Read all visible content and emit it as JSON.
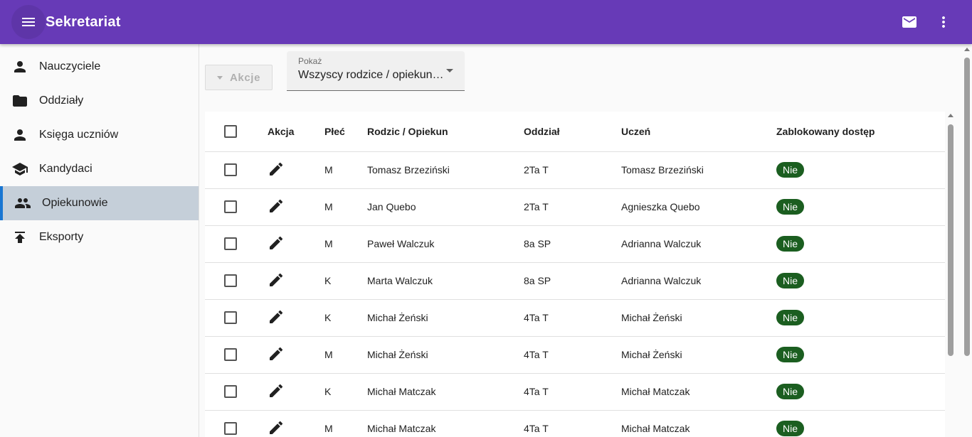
{
  "app": {
    "title": "Sekretariat"
  },
  "topbar": {
    "menu_icon": "menu-icon",
    "mail_icon": "mail-icon",
    "more_icon": "more-vert-icon"
  },
  "sidebar": {
    "items": [
      {
        "label": "Nauczyciele",
        "icon": "person-icon"
      },
      {
        "label": "Oddziały",
        "icon": "folder-icon"
      },
      {
        "label": "Księga uczniów",
        "icon": "person-icon"
      },
      {
        "label": "Kandydaci",
        "icon": "school-icon"
      },
      {
        "label": "Opiekunowie",
        "icon": "people-icon",
        "active": true
      },
      {
        "label": "Eksporty",
        "icon": "upload-icon"
      }
    ]
  },
  "toolbar": {
    "actions_label": "Akcje",
    "show_label": "Pokaż",
    "show_value": "Wszyscy rodzice / opiekunowie"
  },
  "table": {
    "headers": [
      "Akcja",
      "Płeć",
      "Rodzic / Opiekun",
      "Oddział",
      "Uczeń",
      "Zablokowany dostęp"
    ],
    "rows": [
      {
        "sex": "M",
        "parent": "Tomasz Brzeziński",
        "class": "2Ta T",
        "student": "Tomasz Brzeziński",
        "blocked": "Nie"
      },
      {
        "sex": "M",
        "parent": "Jan Quebo",
        "class": "2Ta T",
        "student": "Agnieszka Quebo",
        "blocked": "Nie"
      },
      {
        "sex": "M",
        "parent": "Paweł Walczuk",
        "class": "8a SP",
        "student": "Adrianna Walczuk",
        "blocked": "Nie"
      },
      {
        "sex": "K",
        "parent": "Marta Walczuk",
        "class": "8a SP",
        "student": "Adrianna Walczuk",
        "blocked": "Nie"
      },
      {
        "sex": "K",
        "parent": "Michał Żeński",
        "class": "4Ta T",
        "student": "Michał Żeński",
        "blocked": "Nie"
      },
      {
        "sex": "M",
        "parent": "Michał Żeński",
        "class": "4Ta T",
        "student": "Michał Żeński",
        "blocked": "Nie"
      },
      {
        "sex": "K",
        "parent": "Michał Matczak",
        "class": "4Ta T",
        "student": "Michał Matczak",
        "blocked": "Nie"
      },
      {
        "sex": "M",
        "parent": "Michał Matczak",
        "class": "4Ta T",
        "student": "Michał Matczak",
        "blocked": "Nie"
      }
    ]
  },
  "colors": {
    "appbar": "#673ab7",
    "active_nav": "#c5cfd9",
    "active_indicator": "#1976d2",
    "badge": "#1b5e20"
  }
}
